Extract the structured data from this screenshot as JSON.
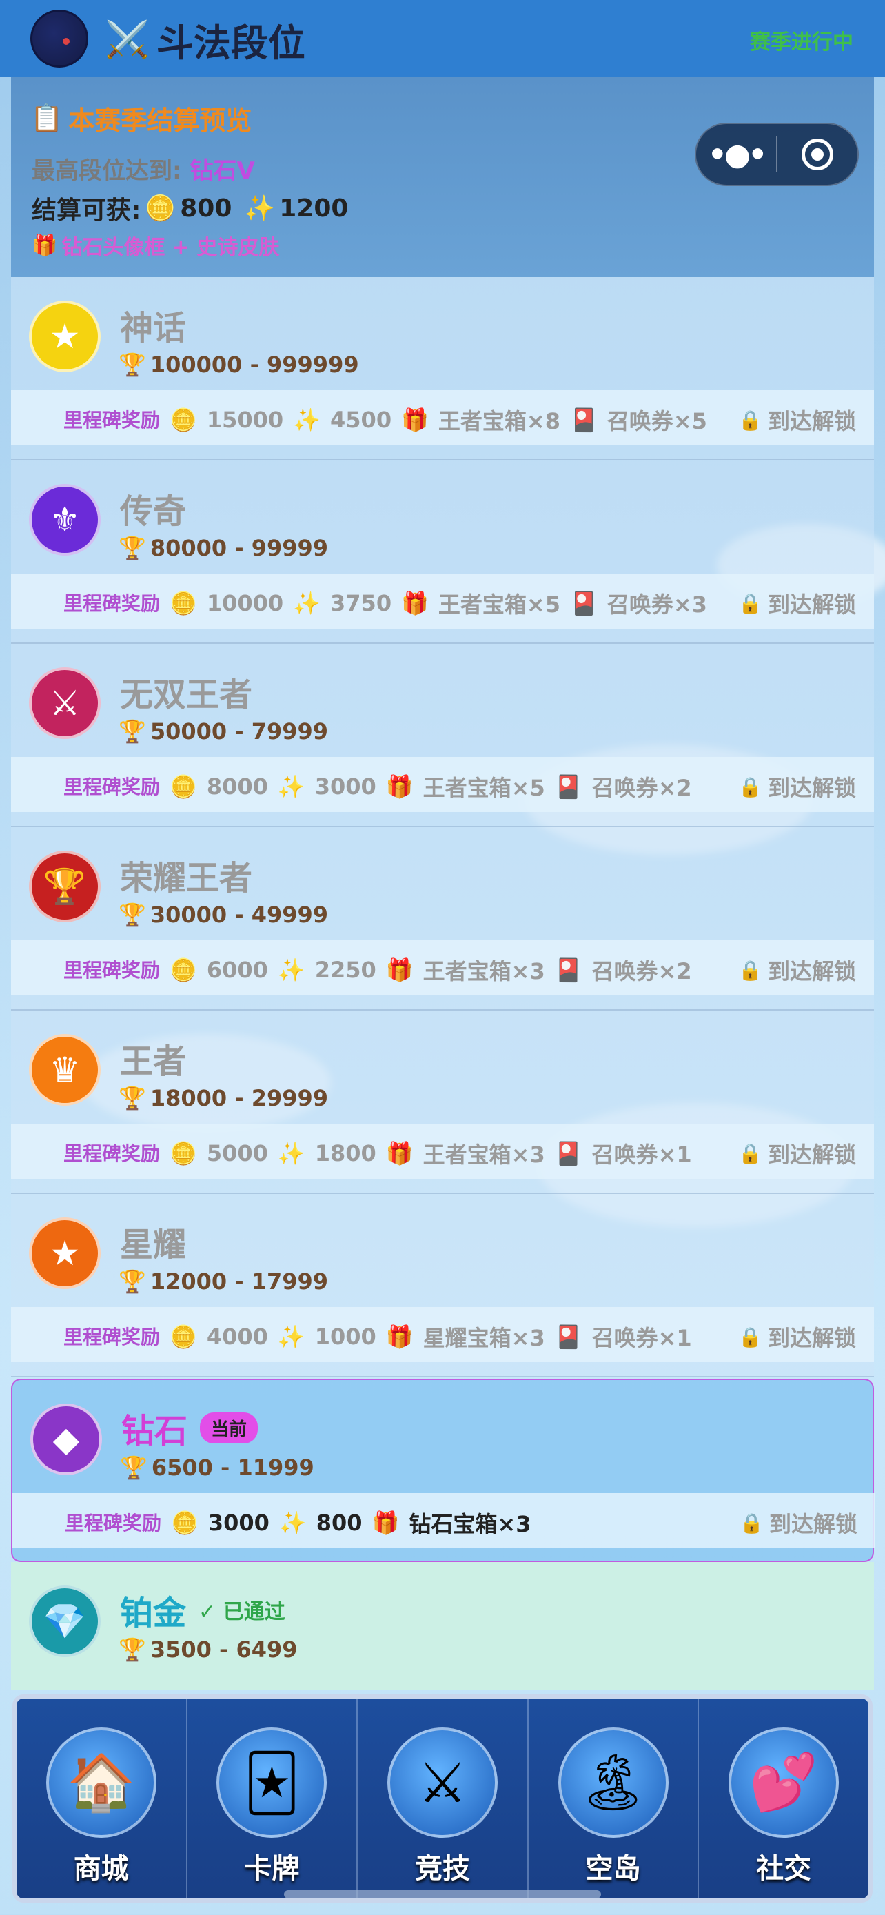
{
  "header": {
    "title": "斗法段位",
    "title_icon": "crossed-swords",
    "season_status": "赛季进行中"
  },
  "summary": {
    "title": "本赛季结算预览",
    "title_icon": "clipboard",
    "highest_label": "最高段位达到:",
    "highest_value": "钻石V",
    "settle_label": "结算可获:",
    "coins": "800",
    "stars": "1200",
    "extra_reward": "钻石头像框 + 史诗皮肤"
  },
  "capsule": {
    "more_icon": "more-dots",
    "target_icon": "target-ring"
  },
  "milestone_label": "里程碑奖励",
  "lock_text": "到达解锁",
  "ranks": [
    {
      "name": "神话",
      "range": "100000 - 999999",
      "rewards": [
        "15000",
        "4500",
        "王者宝箱×8",
        "召唤券×5"
      ],
      "color": "#f5d310",
      "icon": "★"
    },
    {
      "name": "传奇",
      "range": "80000 - 99999",
      "rewards": [
        "10000",
        "3750",
        "王者宝箱×5",
        "召唤券×3"
      ],
      "color": "#6b2bd8",
      "icon": "⚜"
    },
    {
      "name": "无双王者",
      "range": "50000 - 79999",
      "rewards": [
        "8000",
        "3000",
        "王者宝箱×5",
        "召唤券×2"
      ],
      "color": "#c2235e",
      "icon": "⚔"
    },
    {
      "name": "荣耀王者",
      "range": "30000 - 49999",
      "rewards": [
        "6000",
        "2250",
        "王者宝箱×3",
        "召唤券×2"
      ],
      "color": "#c62020",
      "icon": "🏆"
    },
    {
      "name": "王者",
      "range": "18000 - 29999",
      "rewards": [
        "5000",
        "1800",
        "王者宝箱×3",
        "召唤券×1"
      ],
      "color": "#f57c10",
      "icon": "♛"
    },
    {
      "name": "星耀",
      "range": "12000 - 17999",
      "rewards": [
        "4000",
        "1000",
        "星耀宝箱×3",
        "召唤券×1"
      ],
      "color": "#ee6810",
      "icon": "★"
    },
    {
      "name": "钻石",
      "range": "6500 - 11999",
      "rewards": [
        "3000",
        "800",
        "钻石宝箱×3"
      ],
      "color": "#8a36c8",
      "icon": "◆",
      "tag": "当前"
    },
    {
      "name": "铂金",
      "range": "3500 - 6499",
      "color": "#1a9aa8",
      "icon": "💎",
      "tag": "✓ 已通过"
    }
  ],
  "nav": [
    {
      "label": "商城",
      "icon": "🏠"
    },
    {
      "label": "卡牌",
      "icon": "🃏"
    },
    {
      "label": "竞技",
      "icon": "⚔"
    },
    {
      "label": "空岛",
      "icon": "🏝"
    },
    {
      "label": "社交",
      "icon": "💕"
    }
  ]
}
